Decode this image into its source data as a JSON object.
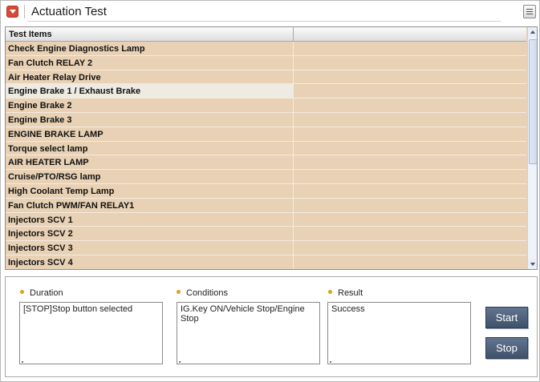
{
  "window": {
    "title": "Actuation Test"
  },
  "table": {
    "headers": [
      "Test Items",
      ""
    ],
    "rows": [
      {
        "item": "Check Engine Diagnostics Lamp",
        "value": ""
      },
      {
        "item": "Fan Clutch RELAY 2",
        "value": ""
      },
      {
        "item": "Air Heater Relay Drive",
        "value": ""
      },
      {
        "item": "Engine Brake 1 / Exhaust Brake",
        "value": ""
      },
      {
        "item": "Engine Brake 2",
        "value": ""
      },
      {
        "item": "Engine Brake 3",
        "value": ""
      },
      {
        "item": "ENGINE BRAKE LAMP",
        "value": ""
      },
      {
        "item": "Torque select lamp",
        "value": ""
      },
      {
        "item": "AIR HEATER LAMP",
        "value": ""
      },
      {
        "item": "Cruise/PTO/RSG lamp",
        "value": ""
      },
      {
        "item": "High Coolant Temp Lamp",
        "value": ""
      },
      {
        "item": "Fan Clutch PWM/FAN RELAY1",
        "value": ""
      },
      {
        "item": "Injectors SCV 1",
        "value": ""
      },
      {
        "item": "Injectors SCV 2",
        "value": ""
      },
      {
        "item": "Injectors SCV 3",
        "value": ""
      },
      {
        "item": "Injectors SCV 4",
        "value": ""
      }
    ],
    "selected_row": "Engine Brake 1 / Exhaust Brake"
  },
  "panel": {
    "duration": {
      "label": "Duration",
      "value": "[STOP]Stop button selected"
    },
    "conditions": {
      "label": "Conditions",
      "value": "IG.Key ON/Vehicle Stop/Engine Stop"
    },
    "result": {
      "label": "Result",
      "value": "Success"
    },
    "start_label": "Start",
    "stop_label": "Stop"
  },
  "colors": {
    "row_bg": "#e8d1b4",
    "selected_row_bg": "#eeebe2",
    "button_bg": "#4a5c76",
    "title_icon": "#d74a37",
    "bullet": "#e0a020"
  },
  "icons": {
    "title": "dropdown-arrow-icon",
    "menu": "menu-icon",
    "scroll_up": "scroll-up-arrow-icon",
    "scroll_down": "scroll-down-arrow-icon"
  }
}
